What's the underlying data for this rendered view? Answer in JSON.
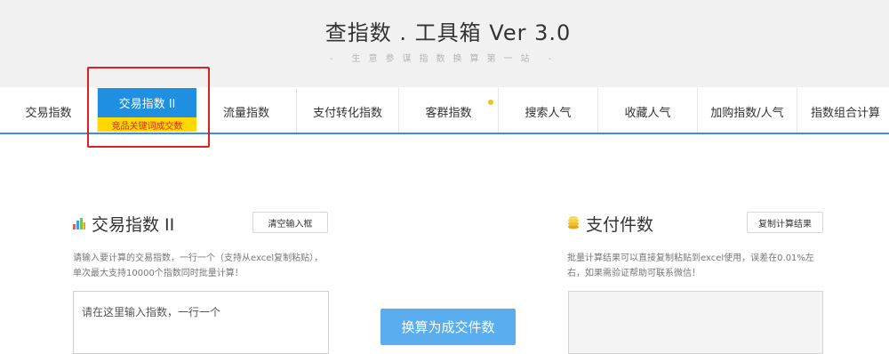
{
  "header": {
    "title": "查指数 . 工具箱 Ver 3.0",
    "subtitle": "- 生意参谋指数换算第一站 -"
  },
  "tabs": [
    {
      "label": "交易指数"
    },
    {
      "label": "交易指数 II",
      "sub_label": "竞品关键词成交数",
      "active": true
    },
    {
      "label": "流量指数"
    },
    {
      "label": "支付转化指数"
    },
    {
      "label": "客群指数",
      "dot": true
    },
    {
      "label": "搜索人气"
    },
    {
      "label": "收藏人气"
    },
    {
      "label": "加购指数/人气"
    },
    {
      "label": "指数组合计算"
    }
  ],
  "left_panel": {
    "title": "交易指数 II",
    "icon": "bar-chart-icon",
    "clear_button": "清空输入框",
    "description": "请输入要计算的交易指数，一行一个（支持从excel复制粘贴），单次最大支持10000个指数同时批量计算！",
    "input_placeholder": "请在这里输入指数，一行一个"
  },
  "convert_button": "换算为成交件数",
  "right_panel": {
    "title": "支付件数",
    "icon": "coins-icon",
    "copy_button": "复制计算结果",
    "description": "批量计算结果可以直接复制粘贴到excel使用，误差在0.01%左右，如果需验证帮助可联系微信！",
    "result_value": ""
  },
  "colors": {
    "accent": "#1e8fe1",
    "tab_underline": "#3a8ee6",
    "sub_label_bg": "#ffd800",
    "sub_label_text": "#e3261b",
    "highlight_border": "#e02020",
    "convert_button_bg": "#5aaef0"
  }
}
